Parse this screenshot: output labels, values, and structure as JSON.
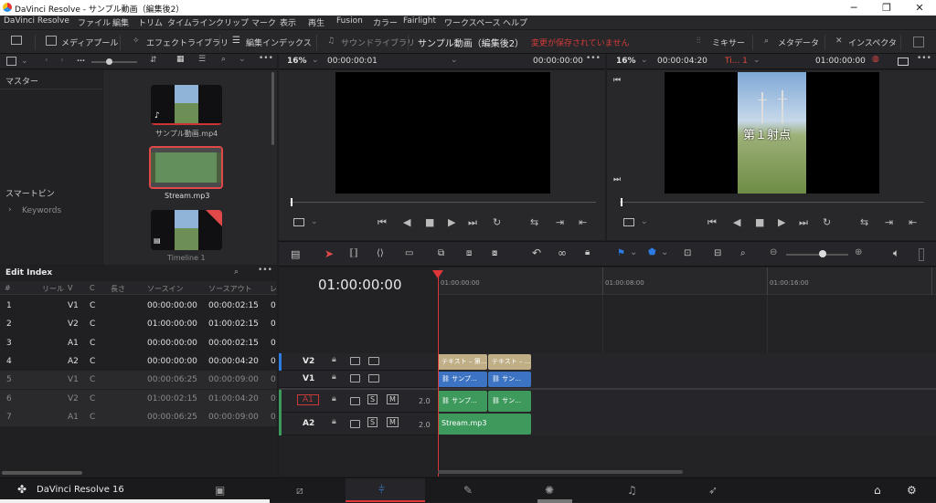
{
  "window": {
    "title": "DaVinci Resolve - サンプル動画（編集後2）",
    "minimize": "─",
    "maximize": "❐",
    "close": "✕"
  },
  "menu": [
    "DaVinci Resolve",
    "ファイル",
    "編集",
    "トリム",
    "タイムライン",
    "クリップ",
    "マーク",
    "表示",
    "再生",
    "Fusion",
    "カラー",
    "Fairlight",
    "ワークスペース",
    "ヘルプ"
  ],
  "toolbar": {
    "media_pool": "メディアプール",
    "effects_library": "エフェクトライブラリ",
    "edit_index": "編集インデックス",
    "sound_library": "サウンドライブラリ",
    "project_title": "サンプル動画（編集後2）",
    "unsaved_notice": "変更が保存されていません",
    "mixer": "ミキサー",
    "metadata": "メタデータ",
    "inspector": "インスペクタ"
  },
  "source_viewer": {
    "zoom": "16%",
    "timecode_left": "00:00:00:01",
    "timecode_right": "00:00:00:00"
  },
  "timeline_viewer": {
    "zoom": "16%",
    "duration": "00:00:04:20",
    "timeline_name": "Ti... 1",
    "timecode": "01:00:00:00",
    "overlay_text": "第１射点"
  },
  "bins": {
    "master": "マスター",
    "smart_bins": "スマートビン",
    "keywords": "Keywords"
  },
  "media_clips": [
    {
      "name": "サンプル動画.mp4"
    },
    {
      "name": "Stream.mp3"
    },
    {
      "name": "Timeline 1"
    }
  ],
  "edit_index": {
    "title": "Edit Index",
    "columns": [
      "#",
      "リール",
      "V",
      "C",
      "長さ",
      "ソースイン",
      "ソースアウト",
      "レ"
    ],
    "rows": [
      {
        "num": "1",
        "v": "V1",
        "c": "C",
        "src_in": "00:00:00:00",
        "src_out": "00:00:02:15",
        "rec": "0",
        "active": true
      },
      {
        "num": "2",
        "v": "V2",
        "c": "C",
        "src_in": "01:00:00:00",
        "src_out": "01:00:02:15",
        "rec": "0",
        "active": true
      },
      {
        "num": "3",
        "v": "A1",
        "c": "C",
        "src_in": "00:00:00:00",
        "src_out": "00:00:02:15",
        "rec": "0",
        "active": true
      },
      {
        "num": "4",
        "v": "A2",
        "c": "C",
        "src_in": "00:00:00:00",
        "src_out": "00:00:04:20",
        "rec": "0",
        "active": true
      },
      {
        "num": "5",
        "v": "V1",
        "c": "C",
        "src_in": "00:00:06:25",
        "src_out": "00:00:09:00",
        "rec": "0",
        "active": false
      },
      {
        "num": "6",
        "v": "V2",
        "c": "C",
        "src_in": "01:00:02:15",
        "src_out": "01:00:04:20",
        "rec": "0",
        "active": false
      },
      {
        "num": "7",
        "v": "A1",
        "c": "C",
        "src_in": "00:00:06:25",
        "src_out": "00:00:09:00",
        "rec": "0",
        "active": false
      }
    ]
  },
  "timeline": {
    "current_timecode": "01:00:00:00",
    "ruler": [
      "01:00:00:00",
      "01:00:08:00",
      "01:00:16:00"
    ],
    "tracks": {
      "v2": "V2",
      "v1": "V1",
      "a1": "A1",
      "a2": "A2",
      "a1_level": "2.0",
      "a2_level": "2.0",
      "solo": "S",
      "mute": "M"
    },
    "clips": {
      "v2_a": "テキスト – 第…",
      "v2_b": "テキスト – …",
      "v1_a": "サンプ…",
      "v1_b": "サン…",
      "a1_a": "サンプ…",
      "a1_b": "サン…",
      "a2": "Stream.mp3"
    }
  },
  "footer": {
    "app": "DaVinci Resolve 16"
  },
  "colors": {
    "accent_red": "#e0363a",
    "video_clip": "#3c73c2",
    "text_clip": "#bfae86",
    "audio_clip": "#3d9a5c"
  }
}
